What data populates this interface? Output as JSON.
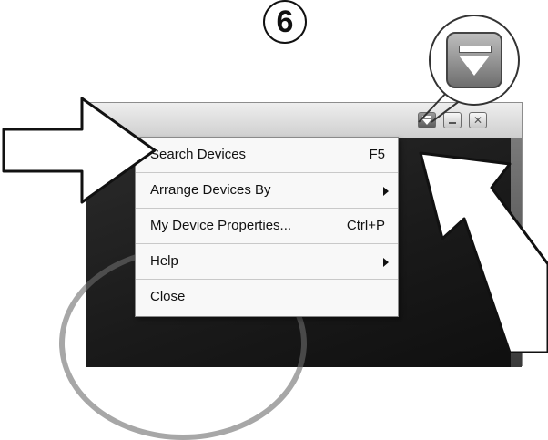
{
  "step": {
    "number": "6"
  },
  "window": {
    "controls": {
      "menu_icon": "dropdown-triangle-icon",
      "minimize_icon": "minimize-icon",
      "close_icon": "close-icon",
      "close_glyph": "✕"
    }
  },
  "menu": {
    "items": [
      {
        "label": "Search Devices",
        "shortcut": "F5",
        "submenu": false
      },
      {
        "label": "Arrange Devices By",
        "shortcut": "",
        "submenu": true
      },
      {
        "label": "My Device Properties...",
        "shortcut": "Ctrl+P",
        "submenu": false
      },
      {
        "label": "Help",
        "shortcut": "",
        "submenu": true
      },
      {
        "label": "Close",
        "shortcut": "",
        "submenu": false
      }
    ]
  },
  "colors": {
    "menu_background": "#f8f8f8",
    "content_background": "#1a1a1a",
    "titlebar": "#dcdcdc"
  }
}
